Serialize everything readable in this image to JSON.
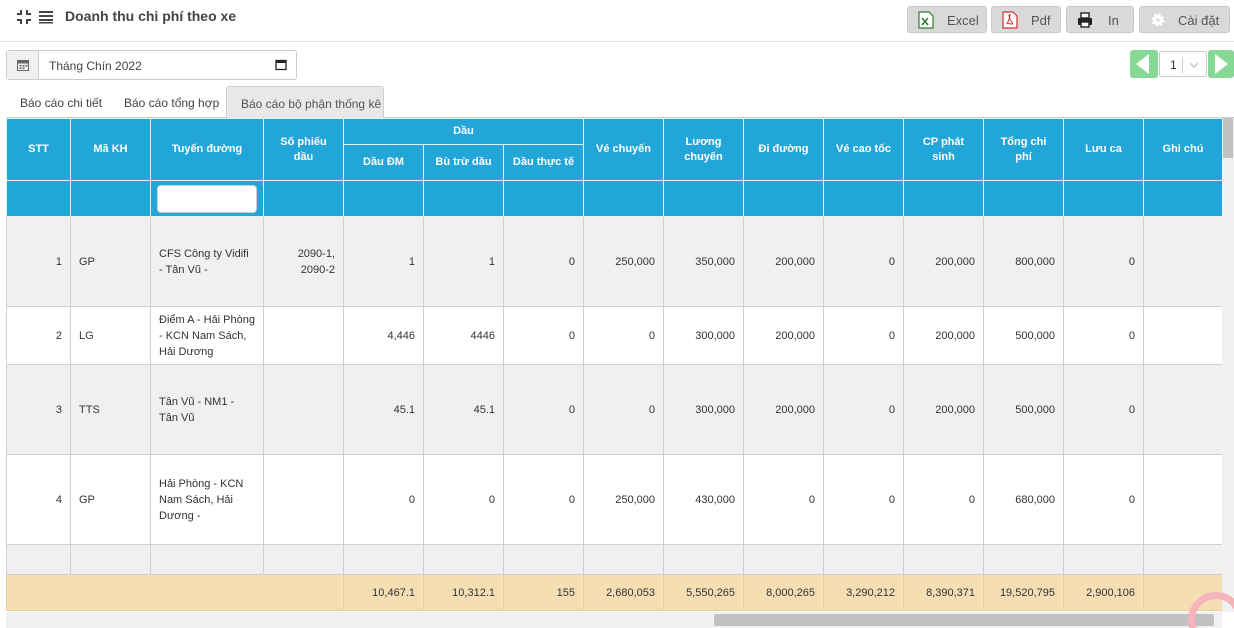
{
  "header": {
    "title": "Doanh thu chi phí theo xe",
    "buttons": {
      "excel": "Excel",
      "pdf": "Pdf",
      "print": "In",
      "settings": "Cài đặt"
    }
  },
  "filter": {
    "month_value": "Tháng Chín 2022"
  },
  "pager": {
    "current_page": "1"
  },
  "tabs": [
    {
      "label": "Báo cáo chi tiết",
      "active": false
    },
    {
      "label": "Báo cáo tổng hợp",
      "active": false
    },
    {
      "label": "Báo cáo bộ phận thống kê",
      "active": true
    }
  ],
  "table": {
    "headers": {
      "stt": "STT",
      "ma_kh": "Mã KH",
      "tuyen_duong": "Tuyến đường",
      "so_phieu_dau": "Số phiếu dầu",
      "dau_group": "Dầu",
      "dau_dm": "Dầu ĐM",
      "bu_tru_dau": "Bù trừ dầu",
      "dau_thuc_te": "Dầu thực tế",
      "ve_chuyen": "Vé chuyến",
      "luong_chuyen": "Lương chuyến",
      "di_duong": "Đi đường",
      "ve_cao_toc": "Vé cao tốc",
      "cp_phat_sinh": "CP phát sinh",
      "tong_chi_phi": "Tổng chi phí",
      "luu_ca": "Lưu ca",
      "ghi_chu": "Ghi chú"
    },
    "rows": [
      {
        "stt": "1",
        "ma_kh": "GP",
        "tuyen": "CFS Công ty Vidifi - Tân Vũ -",
        "so_phieu": "2090-1, 2090-2",
        "dau_dm": "1",
        "bu_tru": "1",
        "thuc_te": "0",
        "ve_chuyen": "250,000",
        "luong": "350,000",
        "di_duong": "200,000",
        "ve_cao_toc": "0",
        "cp_phat_sinh": "200,000",
        "tong": "800,000",
        "luu_ca": "0",
        "ghi_chu": ""
      },
      {
        "stt": "2",
        "ma_kh": "LG",
        "tuyen": "Điểm A - Hải Phòng - KCN Nam Sách, Hải Dương",
        "so_phieu": "",
        "dau_dm": "4,446",
        "bu_tru": "4446",
        "thuc_te": "0",
        "ve_chuyen": "0",
        "luong": "300,000",
        "di_duong": "200,000",
        "ve_cao_toc": "0",
        "cp_phat_sinh": "200,000",
        "tong": "500,000",
        "luu_ca": "0",
        "ghi_chu": ""
      },
      {
        "stt": "3",
        "ma_kh": "TTS",
        "tuyen": "Tân Vũ - NM1 - Tân Vũ",
        "so_phieu": "",
        "dau_dm": "45.1",
        "bu_tru": "45.1",
        "thuc_te": "0",
        "ve_chuyen": "0",
        "luong": "300,000",
        "di_duong": "200,000",
        "ve_cao_toc": "0",
        "cp_phat_sinh": "200,000",
        "tong": "500,000",
        "luu_ca": "0",
        "ghi_chu": ""
      },
      {
        "stt": "4",
        "ma_kh": "GP",
        "tuyen": "Hải Phòng - KCN Nam Sách, Hải Dương -",
        "so_phieu": "",
        "dau_dm": "0",
        "bu_tru": "0",
        "thuc_te": "0",
        "ve_chuyen": "250,000",
        "luong": "430,000",
        "di_duong": "0",
        "ve_cao_toc": "0",
        "cp_phat_sinh": "0",
        "tong": "680,000",
        "luu_ca": "0",
        "ghi_chu": ""
      }
    ],
    "totals": {
      "dau_dm": "10,467.1",
      "bu_tru": "10,312.1",
      "thuc_te": "155",
      "ve_chuyen": "2,680,053",
      "luong": "5,550,265",
      "di_duong": "8,000,265",
      "ve_cao_toc": "3,290,212",
      "cp_phat_sinh": "8,390,371",
      "tong": "19,520,795",
      "luu_ca": "2,900,106"
    }
  },
  "colors": {
    "header_blue": "#22a5d8",
    "totals_row": "#f5deb3",
    "pager_green": "#86d895",
    "button_gray": "#d9d9d9"
  },
  "icons": [
    "compress-icon",
    "list-icon",
    "excel-icon",
    "pdf-icon",
    "printer-icon",
    "gear-icon",
    "calendar-icon",
    "date-picker-icon",
    "chevron-left-icon",
    "chevron-right-icon",
    "chevron-down-icon"
  ]
}
